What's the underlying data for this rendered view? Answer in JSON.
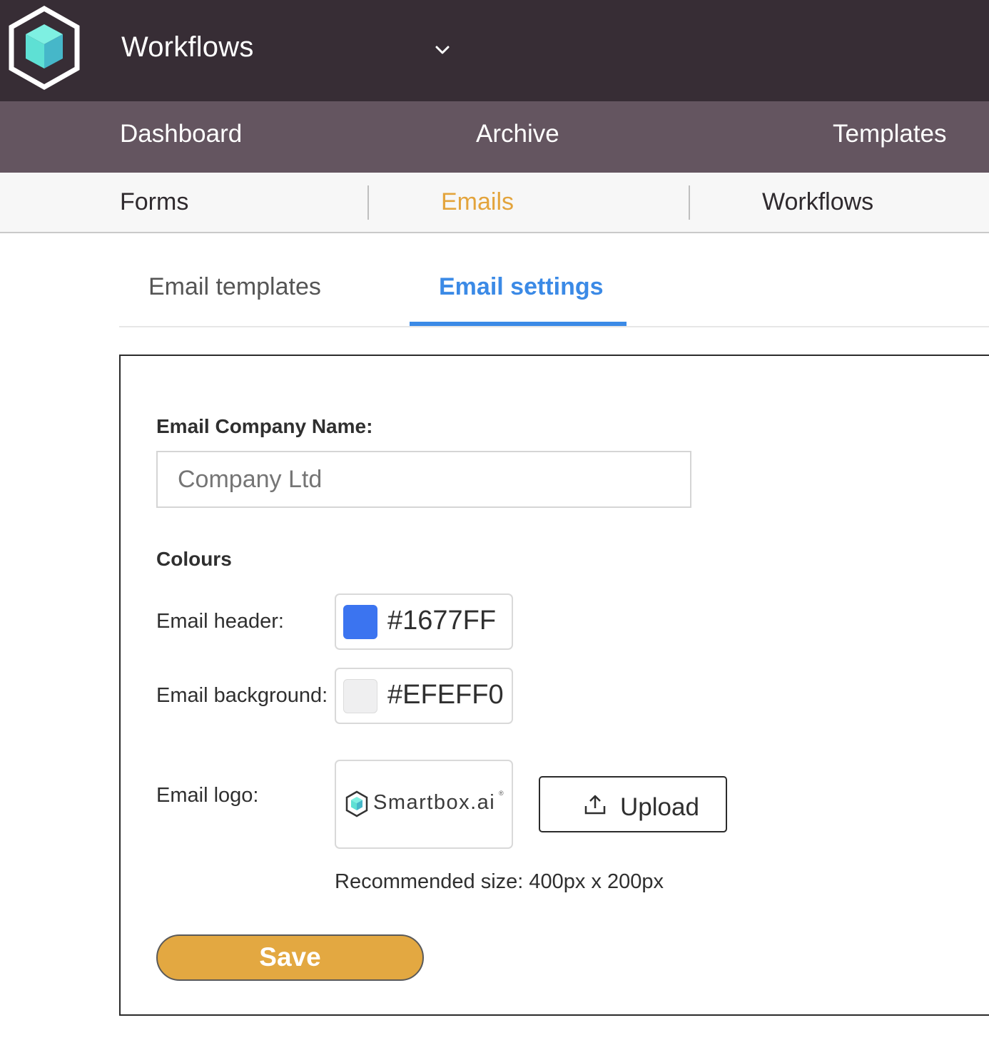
{
  "app": {
    "title": "Workflows",
    "logo_icon": "cube-hexagon-logo-icon",
    "switch_icon": "chevron-down-icon"
  },
  "nav": {
    "items": [
      {
        "label": "Dashboard"
      },
      {
        "label": "Archive"
      },
      {
        "label": "Templates"
      }
    ]
  },
  "subnav": {
    "items": [
      {
        "label": "Forms",
        "active": false
      },
      {
        "label": "Emails",
        "active": true
      },
      {
        "label": "Workflows",
        "active": false
      }
    ]
  },
  "tabs": [
    {
      "label": "Email templates",
      "active": false
    },
    {
      "label": "Email settings",
      "active": true
    }
  ],
  "form": {
    "company_name_label": "Email Company Name:",
    "company_name_placeholder": "Company Ltd",
    "company_name_value": "",
    "colours_heading": "Colours",
    "header_label": "Email header:",
    "header_color": "#1677FF",
    "background_label": "Email background:",
    "background_color": "#EFEFF0",
    "logo_label": "Email logo:",
    "logo_text": "Smartbox.ai",
    "logo_reg_mark": "®",
    "upload_label": "Upload",
    "upload_icon": "upload-icon",
    "hint": "Recommended size: 400px x 200px",
    "save_label": "Save"
  },
  "colors": {
    "topbar": "#372d35",
    "navbar": "#645560",
    "accent_orange": "#e3a43c",
    "accent_blue": "#3b8ae6",
    "save_button": "#e3a841"
  }
}
